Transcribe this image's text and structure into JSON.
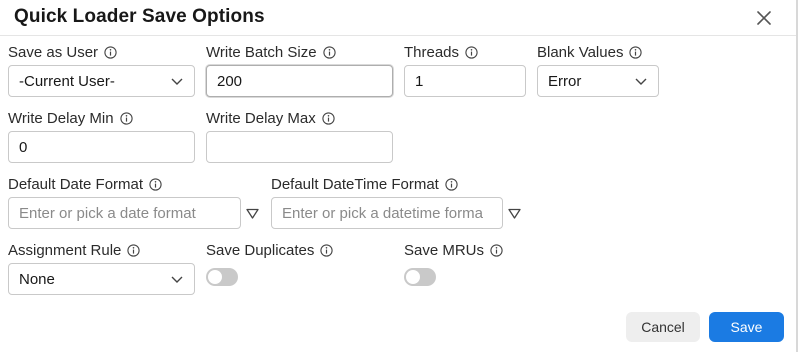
{
  "header": {
    "title": "Quick Loader Save Options"
  },
  "icons": {
    "close": "close-icon",
    "info": "info-icon",
    "chevron": "chevron-down-icon",
    "triangle": "triangle-down-icon"
  },
  "fields": {
    "save_as_user": {
      "label": "Save as User",
      "value": "-Current User-"
    },
    "write_batch_size": {
      "label": "Write Batch Size",
      "value": "200"
    },
    "threads": {
      "label": "Threads",
      "value": "1"
    },
    "blank_values": {
      "label": "Blank Values",
      "value": "Error"
    },
    "write_delay_min": {
      "label": "Write Delay Min",
      "value": "0"
    },
    "write_delay_max": {
      "label": "Write Delay Max",
      "value": ""
    },
    "default_date_format": {
      "label": "Default Date Format",
      "placeholder": "Enter or pick a date format",
      "value": ""
    },
    "default_datetime_format": {
      "label": "Default DateTime Format",
      "placeholder": "Enter or pick a datetime forma",
      "value": ""
    },
    "assignment_rule": {
      "label": "Assignment Rule",
      "value": "None"
    },
    "save_duplicates": {
      "label": "Save Duplicates",
      "checked": false
    },
    "save_mrus": {
      "label": "Save MRUs",
      "checked": false
    }
  },
  "footer": {
    "cancel_label": "Cancel",
    "save_label": "Save"
  },
  "colors": {
    "primary": "#1b7be3",
    "toggle_off": "#c9c9c9",
    "border": "#c9c9c9"
  }
}
